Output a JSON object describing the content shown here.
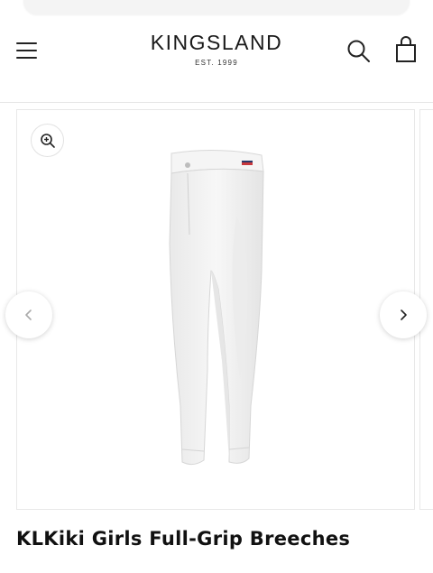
{
  "header": {
    "brand": "KINGSLAND",
    "established": "EST. 1999",
    "menu_icon": "hamburger-menu-icon",
    "search_icon": "search-icon",
    "cart_icon": "shopping-bag-icon"
  },
  "gallery": {
    "zoom_icon": "zoom-in-icon",
    "prev_icon": "chevron-left-icon",
    "next_icon": "chevron-right-icon"
  },
  "product": {
    "title": "KLKiki Girls Full-Grip Breeches",
    "image": "white-breeches-image"
  },
  "colors": {
    "text": "#111111",
    "border": "#e8e8e8",
    "product": "#f2f2f2"
  }
}
